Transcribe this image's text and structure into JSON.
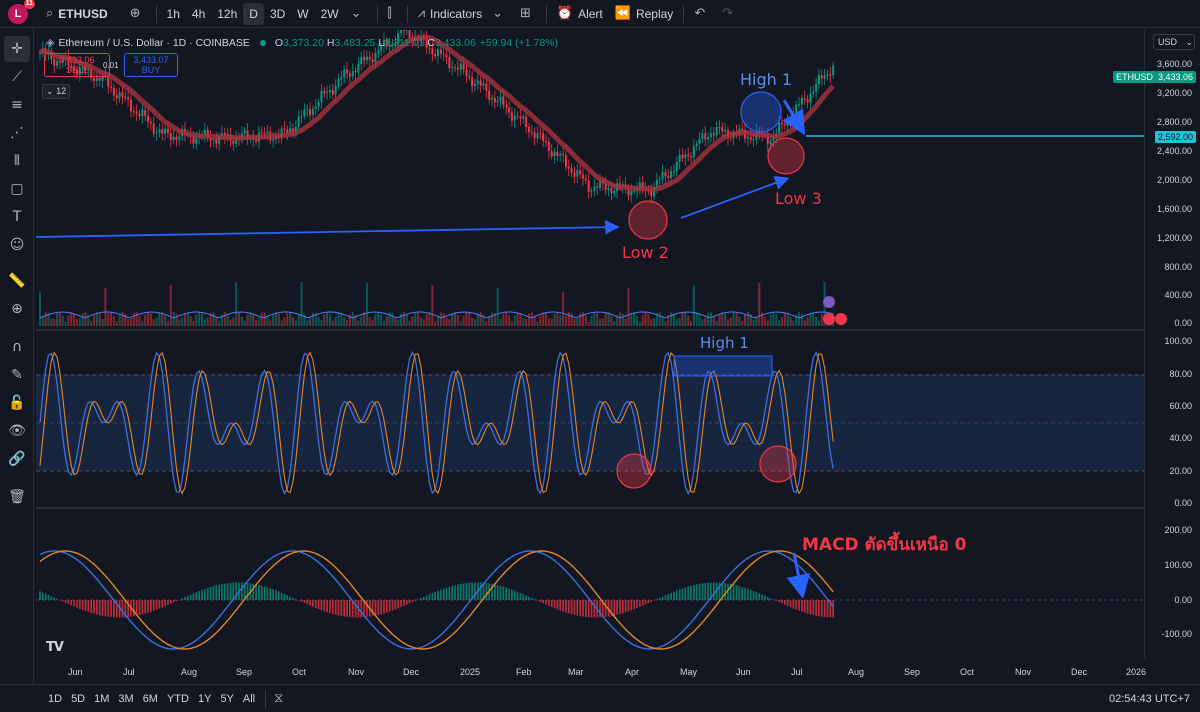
{
  "topbar": {
    "avatar_letter": "L",
    "avatar_badge": "11",
    "symbol": "ETHUSD",
    "intervals": [
      "1h",
      "4h",
      "12h",
      "D",
      "3D",
      "W",
      "2W"
    ],
    "active_interval": "D",
    "indicators_label": "Indicators",
    "alert_label": "Alert",
    "replay_label": "Replay"
  },
  "legend": {
    "title": "Ethereum / U.S. Dollar · 1D · COINBASE",
    "open_key": "O",
    "open": "3,373.20",
    "high_key": "H",
    "high": "3,483.25",
    "low_key": "L",
    "low": "3,311.01",
    "close_key": "C",
    "close": "3,433.06",
    "change": "+59.94 (+1.78%)"
  },
  "trade": {
    "sell_price": "3,433.06",
    "sell_label": "SELL",
    "buy_price": "3,433.07",
    "buy_label": "BUY",
    "spread": "0.01",
    "indicator_count": "12"
  },
  "currency": "USD",
  "price_axis": [
    "3,600.00",
    "3,200.00",
    "2,800.00",
    "2,400.00",
    "2,000.00",
    "1,600.00",
    "1,200.00",
    "800.00",
    "400.00",
    "0.00"
  ],
  "price_tags": {
    "ticker": "ETHUSD",
    "last": "3,433.06",
    "line": "2,592.00"
  },
  "stoch_axis": [
    "100.00",
    "80.00",
    "60.00",
    "40.00",
    "20.00",
    "0.00"
  ],
  "macd_axis": [
    "200.00",
    "100.00",
    "0.00",
    "-100.00"
  ],
  "time_axis": [
    "Jun",
    "Jul",
    "Aug",
    "Sep",
    "Oct",
    "Nov",
    "Dec",
    "2025",
    "Feb",
    "Mar",
    "Apr",
    "May",
    "Jun",
    "Jul",
    "Aug",
    "Sep",
    "Oct",
    "Nov",
    "Dec",
    "2026"
  ],
  "annotations": {
    "high1": "High 1",
    "low2": "Low 2",
    "low3": "Low 3",
    "stoch_high1": "High 1",
    "macd_note": "MACD ตัดขึ้นเหนือ 0"
  },
  "bottombar": {
    "ranges": [
      "1D",
      "5D",
      "1M",
      "3M",
      "6M",
      "YTD",
      "1Y",
      "5Y",
      "All"
    ],
    "clock": "02:54:43 UTC+7"
  },
  "colors": {
    "bg": "#131722",
    "up": "#089981",
    "down": "#f23645",
    "accent": "#2962ff",
    "cyan": "#22c3d6",
    "ma": "#4a7cf3"
  },
  "chart_data": {
    "type": "candlestick",
    "series": [
      {
        "name": "ETHUSD",
        "x": [
          "2024-06",
          "2024-07",
          "2024-08",
          "2024-09",
          "2024-10",
          "2024-11",
          "2024-12",
          "2025-01",
          "2025-02",
          "2025-03",
          "2025-04",
          "2025-05",
          "2025-06",
          "2025-07"
        ],
        "close": [
          3600,
          3250,
          2500,
          2450,
          2500,
          3300,
          3900,
          3300,
          2600,
          1800,
          1750,
          2550,
          2450,
          3433.06
        ]
      }
    ],
    "ylim": [
      0,
      3800
    ],
    "horizontal_line": 2592
  }
}
